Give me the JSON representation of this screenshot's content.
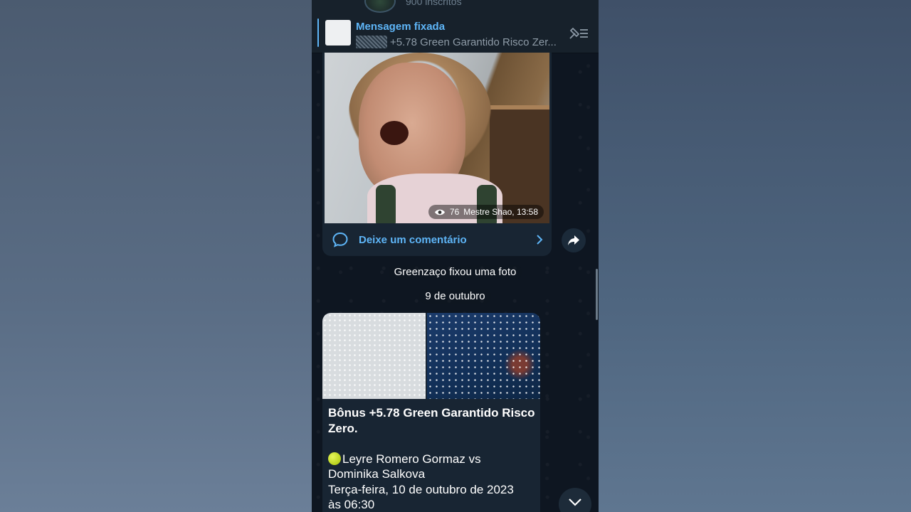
{
  "channel": {
    "subscribers": "900 inscritos"
  },
  "pinned": {
    "title": "Mensagem fixada",
    "text": "+5.78 Green Garantido Risco Zer..."
  },
  "video_post": {
    "views": "76",
    "author_time": "Mestre Shao, 13:58",
    "comment_label": "Deixe um comentário"
  },
  "service": {
    "pinned_notice": "Greenzaço fixou uma foto",
    "date": "9 de outubro"
  },
  "post": {
    "title": "Bônus +5.78 Green Garantido Risco Zero.",
    "match_line1": "Leyre Romero Gormaz vs",
    "match_line2": "Dominika Salkova",
    "date_line": "Terça-feira, 10 de outubro de 2023",
    "time_line": "às 06:30"
  },
  "icons": {
    "pin": "unpin-list-icon",
    "views": "eye-icon",
    "comment": "comment-bubble-icon",
    "share": "share-arrow-icon",
    "scroll": "chevron-down-icon"
  },
  "colors": {
    "accent": "#5eb5f7",
    "background": "#0e1621",
    "bubble": "#182533"
  }
}
